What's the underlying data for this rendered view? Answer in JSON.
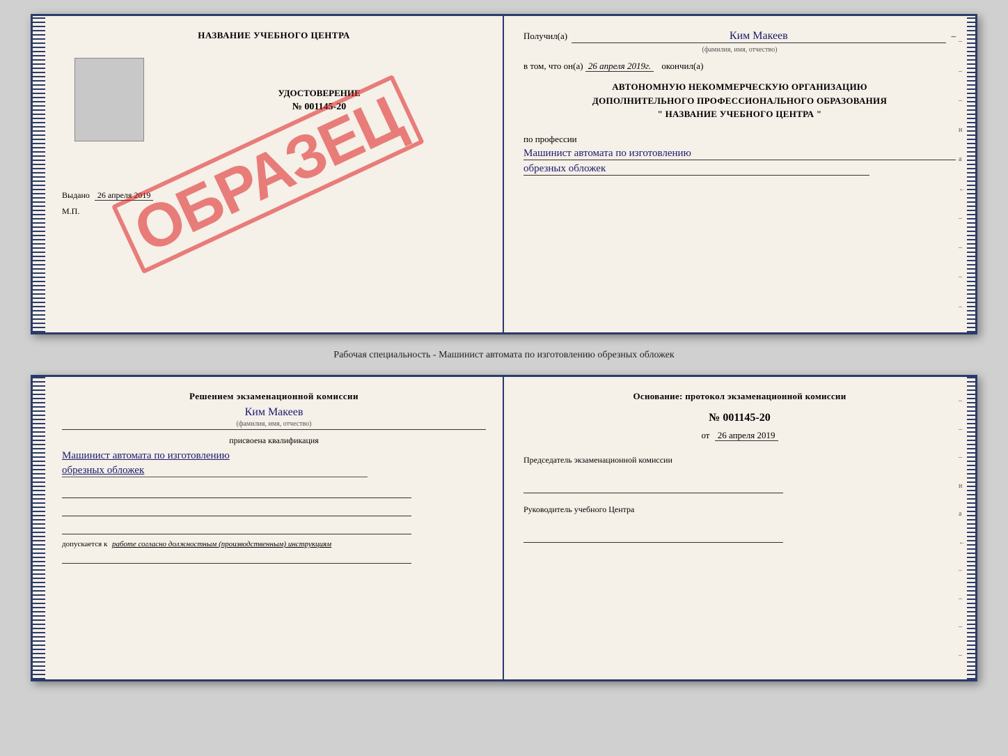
{
  "top_document": {
    "left": {
      "title": "НАЗВАНИЕ УЧЕБНОГО ЦЕНТРА",
      "watermark": "ОБРАЗЕЦ",
      "cert_title": "УДОСТОВЕРЕНИЕ",
      "cert_number": "№ 001145-20",
      "issued_label": "Выдано",
      "issued_date": "26 апреля 2019",
      "mp_label": "М.П."
    },
    "right": {
      "recipient_label": "Получил(а)",
      "recipient_name": "Ким Макеев",
      "fio_subtext": "(фамилия, имя, отчество)",
      "date_prefix": "в том, что он(а)",
      "date_value": "26 апреля 2019г.",
      "date_suffix": "окончил(а)",
      "org_line1": "АВТОНОМНУЮ НЕКОММЕРЧЕСКУЮ ОРГАНИЗАЦИЮ",
      "org_line2": "ДОПОЛНИТЕЛЬНОГО ПРОФЕССИОНАЛЬНОГО ОБРАЗОВАНИЯ",
      "org_line3": "\"  НАЗВАНИЕ УЧЕБНОГО ЦЕНТРА  \"",
      "profession_label": "по профессии",
      "profession_line1": "Машинист автомата по изготовлению",
      "profession_line2": "обрезных обложек"
    }
  },
  "caption": "Рабочая специальность - Машинист автомата по изготовлению обрезных обложек",
  "bottom_document": {
    "left": {
      "commission_prefix": "Решением экзаменационной комиссии",
      "person_name": "Ким Макеев",
      "fio_subtext": "(фамилия, имя, отчество)",
      "qualification_label": "присвоена квалификация",
      "qualification_line1": "Машинист автомата по изготовлению",
      "qualification_line2": "обрезных обложек",
      "allowed_prefix": "допускается к",
      "allowed_text": "работе согласно должностным (производственным) инструкциям"
    },
    "right": {
      "basis_title": "Основание: протокол экзаменационной комиссии",
      "protocol_number": "№ 001145-20",
      "date_prefix": "от",
      "date_value": "26 апреля 2019",
      "chairman_label": "Председатель экзаменационной комиссии",
      "director_label": "Руководитель учебного Центра"
    }
  },
  "dashes": [
    "–",
    "–",
    "–",
    "и",
    "а",
    "←",
    "–",
    "–",
    "–",
    "–"
  ],
  "side_dashes_right": [
    "–",
    "–",
    "–",
    "и",
    "а",
    "←",
    "–",
    "–",
    "–",
    "–"
  ]
}
